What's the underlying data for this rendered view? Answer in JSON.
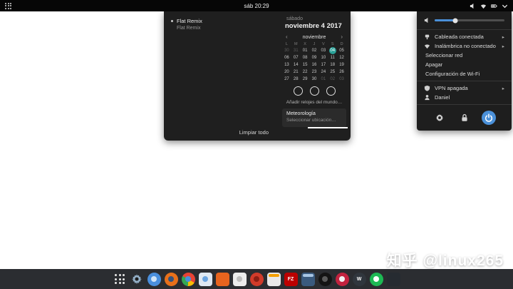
{
  "colors": {
    "accent": "#4a90d9",
    "today": "#2aa198"
  },
  "topbar": {
    "clock": "sáb 20:29"
  },
  "calendar_panel": {
    "notifications": {
      "items": [
        {
          "title": "Flat Remix",
          "body": "Flat Remix"
        }
      ],
      "clear_all": "Limpiar todo"
    },
    "date": {
      "weekday": "sábado",
      "full": "noviembre  4 2017"
    },
    "calendar": {
      "month": "noviembre",
      "prev": "‹",
      "next": "›",
      "day_headers": [
        "L",
        "M",
        "X",
        "J",
        "V",
        "S",
        "D"
      ],
      "weeks": [
        [
          "30",
          "31",
          "01",
          "02",
          "03",
          "04",
          "05"
        ],
        [
          "06",
          "07",
          "08",
          "09",
          "10",
          "11",
          "12"
        ],
        [
          "13",
          "14",
          "15",
          "16",
          "17",
          "18",
          "19"
        ],
        [
          "20",
          "21",
          "22",
          "23",
          "24",
          "25",
          "26"
        ],
        [
          "27",
          "28",
          "29",
          "30",
          "01",
          "02",
          "03"
        ]
      ],
      "today": [
        0,
        5
      ],
      "dim": [
        [
          0,
          0
        ],
        [
          0,
          1
        ],
        [
          4,
          4
        ],
        [
          4,
          5
        ],
        [
          4,
          6
        ]
      ]
    },
    "event_circles": 3,
    "add_clocks": "Añadir relojes del mundo…",
    "weather": {
      "title": "Meteorología",
      "action": "Seleccionar ubicación…"
    }
  },
  "system_menu": {
    "volume_level": 0.3,
    "items": [
      {
        "label": "Cableada conectada",
        "icon": "wired",
        "arrow": true
      },
      {
        "label": "Inalámbrica no conectado",
        "icon": "wifi",
        "arrow": true
      },
      {
        "label": "Seleccionar red",
        "sub": true
      },
      {
        "label": "Apagar",
        "sub": true
      },
      {
        "label": "Configuración de Wi-Fi",
        "sub": true,
        "divider_after": true
      },
      {
        "label": "VPN apagada",
        "icon": "shield",
        "arrow": true
      },
      {
        "label": "Daniel",
        "icon": "user"
      }
    ],
    "buttons": [
      {
        "name": "settings"
      },
      {
        "name": "lock"
      },
      {
        "name": "power",
        "accent": "#4a90d9"
      }
    ]
  },
  "dock": {
    "items": [
      {
        "name": "show-apps",
        "shape": "grid"
      },
      {
        "name": "settings",
        "shape": "gear",
        "color": "#93aec6"
      },
      {
        "name": "chromium",
        "shape": "circle",
        "bg": "#4a8fdd",
        "inner": "#cfe3f7"
      },
      {
        "name": "firefox",
        "shape": "circle",
        "bg": "#e8701a",
        "inner": "#35537c"
      },
      {
        "name": "chrome",
        "shape": "circle",
        "chrome": true,
        "inner": "#4a8fdd"
      },
      {
        "name": "files",
        "shape": "square",
        "bg": "#dfe8f2",
        "inner": "#6aa4e0"
      },
      {
        "name": "orange-app",
        "shape": "square",
        "bg": "#e8641e"
      },
      {
        "name": "documents",
        "shape": "square",
        "bg": "#ececec",
        "inner": "#bdbdbd"
      },
      {
        "name": "red-app",
        "shape": "circle",
        "bg": "#d13b2a",
        "inner": "#8c1f14"
      },
      {
        "name": "text-editor",
        "shape": "square",
        "bg": "#e9e9e9",
        "accent": "#f59f00"
      },
      {
        "name": "filezilla",
        "shape": "square",
        "bg": "#bb0000",
        "glyph": "FZ",
        "fg": "#ffffff"
      },
      {
        "name": "terminal",
        "shape": "square",
        "bg": "#3a5a7e",
        "accent": "#a9c6e4"
      },
      {
        "name": "camera",
        "shape": "circle",
        "bg": "#141414",
        "inner": "#5a5a5a"
      },
      {
        "name": "media-player",
        "shape": "circle",
        "bg": "#c2233f",
        "inner": "#f1f1f1"
      },
      {
        "name": "wine",
        "shape": "circle",
        "bg": "#30363d",
        "glyph": "W",
        "fg": "#ffffff"
      },
      {
        "name": "spotify",
        "shape": "circle",
        "bg": "#1db954",
        "inner": "#ffffff"
      },
      {
        "name": "dark-app",
        "shape": "square",
        "bg": "#262b31"
      }
    ]
  },
  "watermark": "知乎 @linux265"
}
